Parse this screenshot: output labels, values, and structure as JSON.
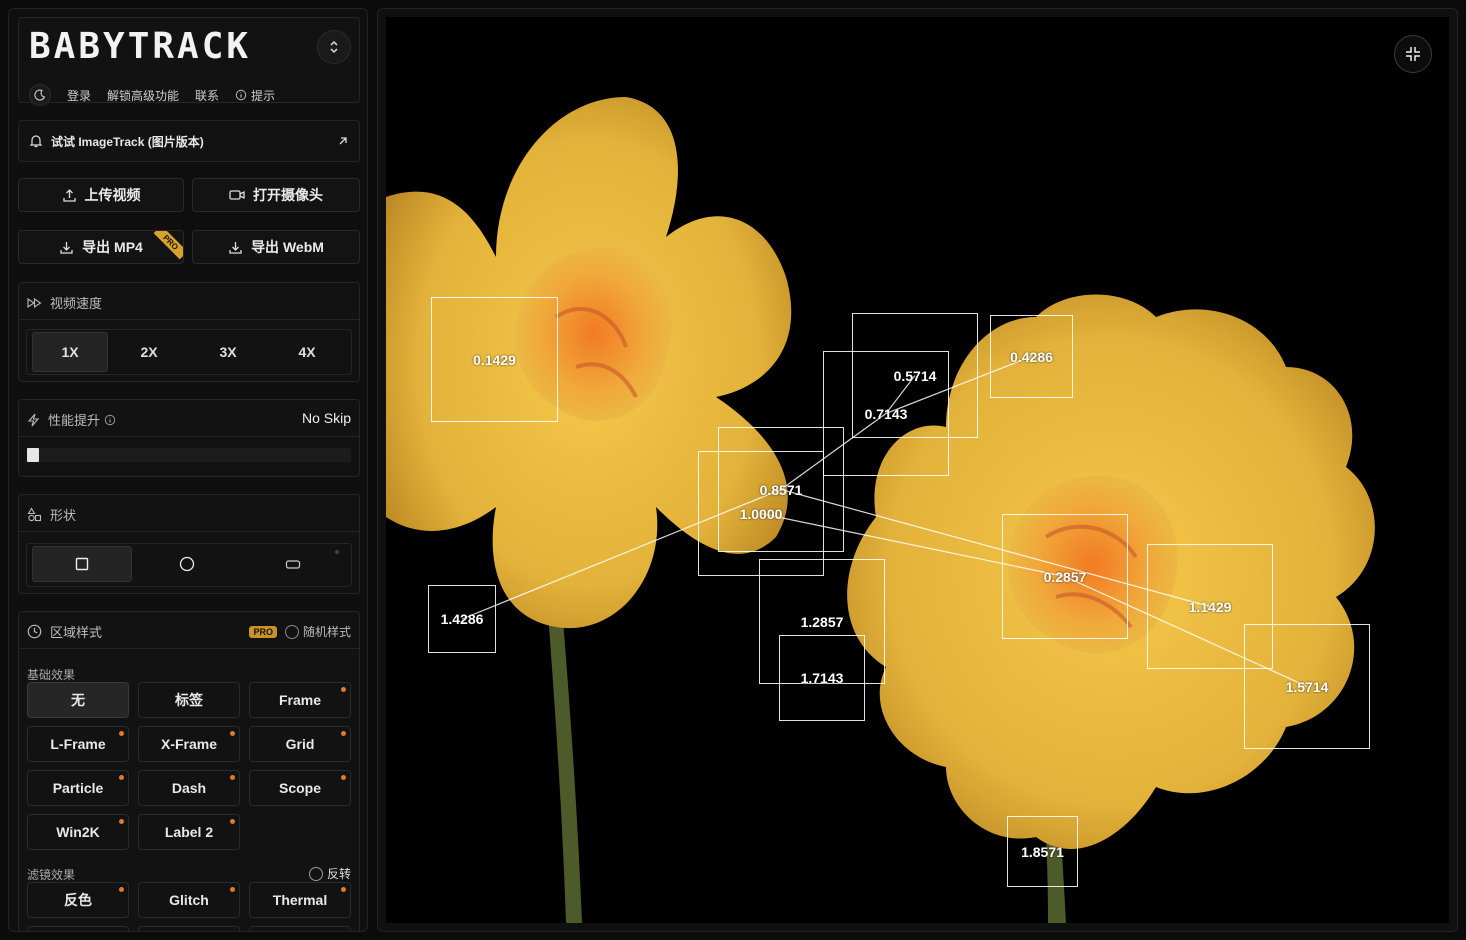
{
  "app": {
    "logo_text": "BABYTRACK"
  },
  "top_links": {
    "login": "登录",
    "unlock": "解锁高级功能",
    "contact": "联系",
    "tips": "提示"
  },
  "promo": {
    "label": "试试 ImageTrack (图片版本)"
  },
  "actions": {
    "upload": "上传视频",
    "camera": "打开摄像头",
    "export_mp4": "导出 MP4",
    "export_webm": "导出 WebM",
    "pro_ribbon": "PRO"
  },
  "speed": {
    "title": "视频速度",
    "options": [
      "1X",
      "2X",
      "3X",
      "4X"
    ],
    "selected": "1X"
  },
  "performance": {
    "title": "性能提升",
    "value": "No Skip",
    "slider_level": 0
  },
  "shape": {
    "title": "形状",
    "options": [
      "square",
      "circle",
      "rounded-rectangle"
    ],
    "selected": "square"
  },
  "region_style": {
    "title": "区域样式",
    "pro_badge": "PRO",
    "random_label": "随机样式",
    "basic_title": "基础效果",
    "basic_effects": [
      "无",
      "标签",
      "Frame",
      "L-Frame",
      "X-Frame",
      "Grid",
      "Particle",
      "Dash",
      "Scope",
      "Win2K",
      "Label 2"
    ],
    "selected": "无",
    "filter_title": "滤镜效果",
    "invert_label": "反转",
    "filter_effects": [
      "反色",
      "Glitch",
      "Thermal"
    ]
  },
  "tracks": {
    "labels": [
      "0.1429",
      "0.5714",
      "0.7143",
      "0.4286",
      "0.8571",
      "1.0000",
      "0.2857",
      "1.1429",
      "1.4286",
      "1.2857",
      "1.7143",
      "1.5714",
      "1.8571"
    ]
  },
  "colors": {
    "accent": "#c9932c",
    "pro_dot": "#e07a2a",
    "box": "#ffffff"
  }
}
